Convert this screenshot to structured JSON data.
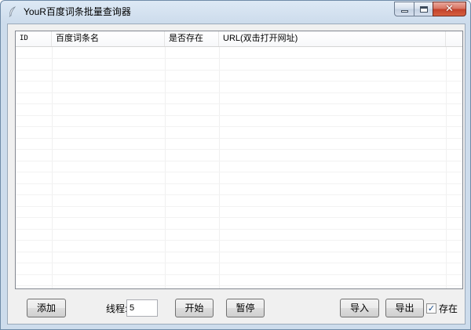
{
  "window": {
    "title": "YouR百度词条批量查询器",
    "app_icon": "feather-icon",
    "controls": {
      "minimize": "minimize-icon",
      "maximize": "maximize-icon",
      "close": "close-icon",
      "close_glyph": "✕"
    }
  },
  "table": {
    "columns": [
      "ID",
      "百度词条名",
      "是否存在",
      "URL(双击打开网址)"
    ],
    "rows": []
  },
  "buttons": {
    "add": "添加",
    "start": "开始",
    "pause": "暂停",
    "import": "导入",
    "export": "导出"
  },
  "threads": {
    "label": "线程:",
    "value": "5"
  },
  "exists_filter": {
    "label": "存在",
    "checked": true,
    "check_glyph": "✓"
  }
}
